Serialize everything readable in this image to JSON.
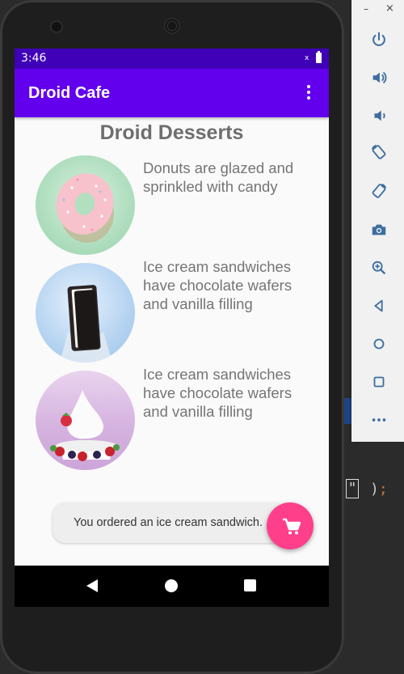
{
  "status_bar": {
    "time": "3:46",
    "signal_glyph": "x"
  },
  "app_bar": {
    "title": "Droid Cafe",
    "menu_icon": "more-vert-icon"
  },
  "main": {
    "heading": "Droid Desserts",
    "desserts": [
      {
        "image": "donut",
        "description": "Donuts are glazed and sprinkled with candy"
      },
      {
        "image": "ice-cream-sandwich",
        "description": "Ice cream sandwiches have chocolate wafers and vanilla filling"
      },
      {
        "image": "froyo",
        "description": "Ice cream sandwiches have chocolate wafers and vanilla filling"
      }
    ]
  },
  "snackbar": {
    "message": "You ordered an ice cream sandwich."
  },
  "fab": {
    "icon": "shopping-cart-icon"
  },
  "nav_bar": {
    "icons": [
      "back-icon",
      "home-icon",
      "recents-icon"
    ]
  },
  "emulator_panel": {
    "window_minimize": "–",
    "window_close": "×",
    "buttons": [
      "power-icon",
      "volume-up-icon",
      "volume-down-icon",
      "rotate-left-icon",
      "rotate-right-icon",
      "camera-icon",
      "zoom-icon",
      "back-icon",
      "home-icon",
      "overview-icon",
      "more-icon"
    ]
  },
  "ide_background": {
    "code_fragment": "\" );"
  },
  "colors": {
    "status_bar": "#3f00b8",
    "app_bar": "#6200ee",
    "fab": "#ff3f8a"
  }
}
